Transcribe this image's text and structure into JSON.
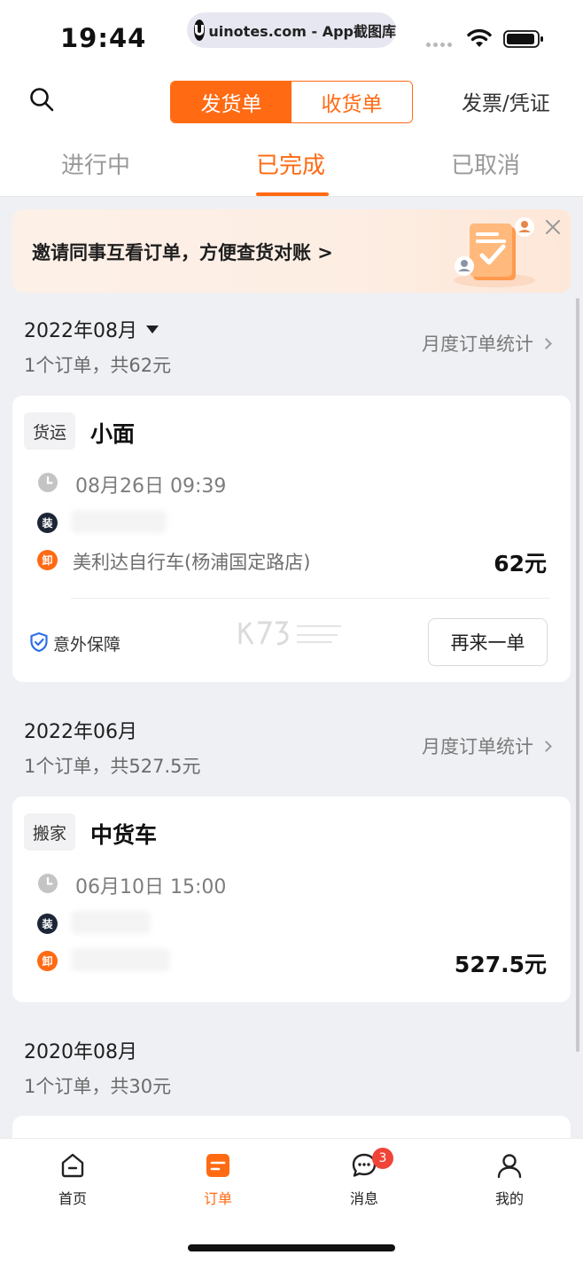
{
  "status_bar": {
    "time": "19:44",
    "url": "uinotes.com - App截图库"
  },
  "header": {
    "segments": [
      {
        "label": "发货单",
        "active": true
      },
      {
        "label": "收货单",
        "active": false
      }
    ],
    "invoice_link": "发票/凭证",
    "tabs": [
      {
        "label": "进行中",
        "active": false
      },
      {
        "label": "已完成",
        "active": true
      },
      {
        "label": "已取消",
        "active": false
      }
    ]
  },
  "banner": {
    "text": "邀请同事互看订单，方便查货对账 >"
  },
  "months": [
    {
      "title": "2022年08月",
      "summary": "1个订单，共62元",
      "stats_link": "月度订单统计",
      "orders": [
        {
          "badge": "货运",
          "vehicle": "小面",
          "time": "08月26日 09:39",
          "load_label": "装",
          "unload_label": "卸",
          "unload_address": "美利达自行车(杨浦国定路店)",
          "price": "62元",
          "insurance": "意外保障",
          "reorder": "再来一单"
        }
      ]
    },
    {
      "title": "2022年06月",
      "summary": "1个订单，共527.5元",
      "stats_link": "月度订单统计",
      "orders": [
        {
          "badge": "搬家",
          "vehicle": "中货车",
          "time": "06月10日 15:00",
          "load_label": "装",
          "unload_label": "卸",
          "price": "527.5元"
        }
      ]
    },
    {
      "title": "2020年08月",
      "summary": "1个订单，共30元"
    }
  ],
  "bottom_nav": [
    {
      "label": "首页",
      "icon": "home-icon",
      "active": false
    },
    {
      "label": "订单",
      "icon": "orders-icon",
      "active": true
    },
    {
      "label": "消息",
      "icon": "message-icon",
      "active": false,
      "badge": "3"
    },
    {
      "label": "我的",
      "icon": "profile-icon",
      "active": false
    }
  ],
  "colors": {
    "accent": "#ff6a13",
    "background": "#eff0f4",
    "badge_red": "#f04438"
  }
}
